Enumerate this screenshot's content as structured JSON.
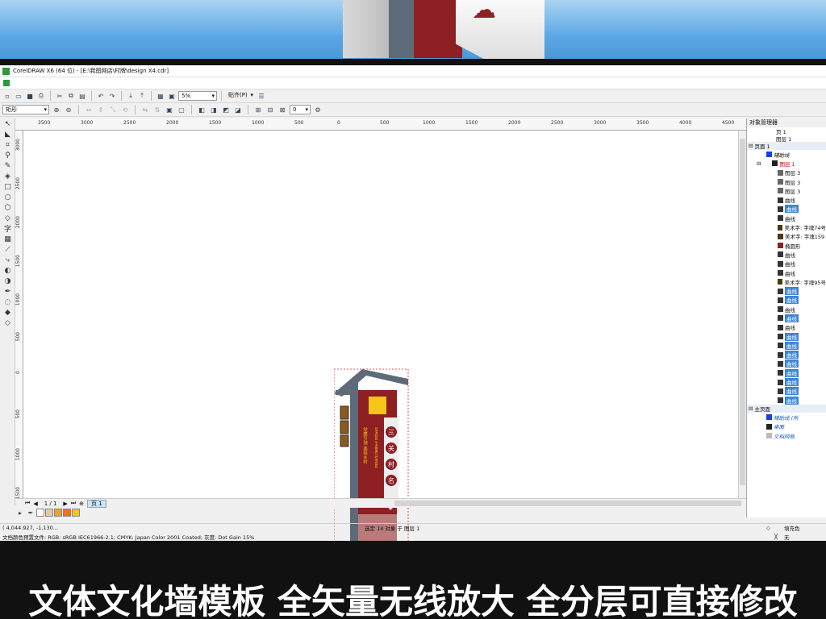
{
  "window": {
    "title": "CorelDRAW X6 (64 位) - [E:\\我图网店\\村牌\\design X4.cdr]"
  },
  "toolbar": {
    "zoom": "5%",
    "snap_label": "贴齐(P)"
  },
  "propbar": {
    "object_type": "矩形",
    "angle": "0"
  },
  "ruler": {
    "top_ticks": [
      "3500",
      "3000",
      "2500",
      "2000",
      "1500",
      "1000",
      "500",
      "0",
      "500",
      "1000",
      "1500",
      "2000",
      "2500",
      "3000",
      "3500",
      "4000",
      "4500"
    ],
    "left_ticks": [
      "3000",
      "2500",
      "2000",
      "1500",
      "1000",
      "500",
      "0",
      "500",
      "1000",
      "1500"
    ]
  },
  "page_nav": {
    "counter": "1 / 1",
    "page_tab": "页 1"
  },
  "sign": {
    "village_chars": [
      "三",
      "关",
      "村",
      "名"
    ],
    "slogan_left": "党建引领  美丽乡村",
    "slogan_mid": "月清润民  生态富农  环境宜居"
  },
  "docker": {
    "title": "对象管理器",
    "page_label": "页 1",
    "layer_label": "图层 1",
    "page_group": "页面 1",
    "guides": "辅助线",
    "layer1": "图层 1",
    "objects": [
      {
        "label": "图层 3",
        "icon": "layer",
        "selected": false
      },
      {
        "label": "图层 3",
        "icon": "layer",
        "selected": false
      },
      {
        "label": "图层 3",
        "icon": "layer",
        "selected": false
      },
      {
        "label": "曲线",
        "icon": "curve",
        "selected": false
      },
      {
        "label": "曲线",
        "icon": "curve",
        "selected": true
      },
      {
        "label": "曲线",
        "icon": "curve",
        "selected": false
      },
      {
        "label": "美术字: 字魂74号",
        "icon": "text",
        "selected": false
      },
      {
        "label": "美术字: 字魂159",
        "icon": "text",
        "selected": false
      },
      {
        "label": "椭圆形",
        "icon": "ellipse",
        "selected": false
      },
      {
        "label": "曲线",
        "icon": "curve",
        "selected": false
      },
      {
        "label": "曲线",
        "icon": "curve",
        "selected": false
      },
      {
        "label": "曲线",
        "icon": "curve",
        "selected": false
      },
      {
        "label": "美术字: 字魂95号",
        "icon": "text",
        "selected": false
      },
      {
        "label": "曲线",
        "icon": "curve",
        "selected": true
      },
      {
        "label": "曲线",
        "icon": "curve",
        "selected": true
      },
      {
        "label": "曲线",
        "icon": "curve",
        "selected": false
      },
      {
        "label": "曲线",
        "icon": "curve",
        "selected": true
      },
      {
        "label": "曲线",
        "icon": "curve",
        "selected": false
      },
      {
        "label": "曲线",
        "icon": "curve",
        "selected": true
      },
      {
        "label": "曲线",
        "icon": "curve",
        "selected": true
      },
      {
        "label": "曲线",
        "icon": "curve",
        "selected": true
      },
      {
        "label": "曲线",
        "icon": "curve",
        "selected": true
      },
      {
        "label": "曲线",
        "icon": "curve",
        "selected": true
      },
      {
        "label": "曲线",
        "icon": "curve",
        "selected": true
      },
      {
        "label": "曲线",
        "icon": "curve",
        "selected": true
      },
      {
        "label": "曲线",
        "icon": "curve",
        "selected": true
      }
    ],
    "master_group": "主页面",
    "master_items": [
      "辅助线 (所",
      "桌面",
      "文档网格"
    ]
  },
  "status": {
    "coords": "( 4,044.927, -1,130...",
    "selection": "选定 14 对象 于 图层 1",
    "color_profile": "文档颜色预置文件: RGB: sRGB IEC61966-2.1; CMYK: Japan Color 2001 Coated; 灰度: Dot Gain 15%",
    "fill_label": "填充色",
    "outline_label": "无"
  },
  "caption": "文体文化墙模板 全矢量无线放大 全分层可直接修改",
  "colors": {
    "sign_red": "#8e1f22",
    "sign_grey": "#5d6b79",
    "select_blue": "#3d84d6"
  }
}
